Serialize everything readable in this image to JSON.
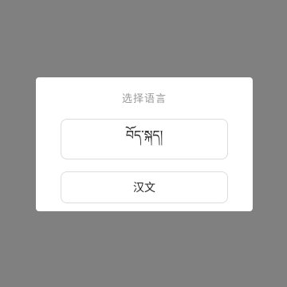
{
  "dialog": {
    "title": "选择语言",
    "options": [
      {
        "label": "བོད་སྐད།"
      },
      {
        "label": "汉文"
      }
    ]
  },
  "colors": {
    "overlay": "#808080",
    "dialog_background": "#ffffff",
    "title_text": "#9a9a9a",
    "option_border": "#dcdcdc"
  }
}
